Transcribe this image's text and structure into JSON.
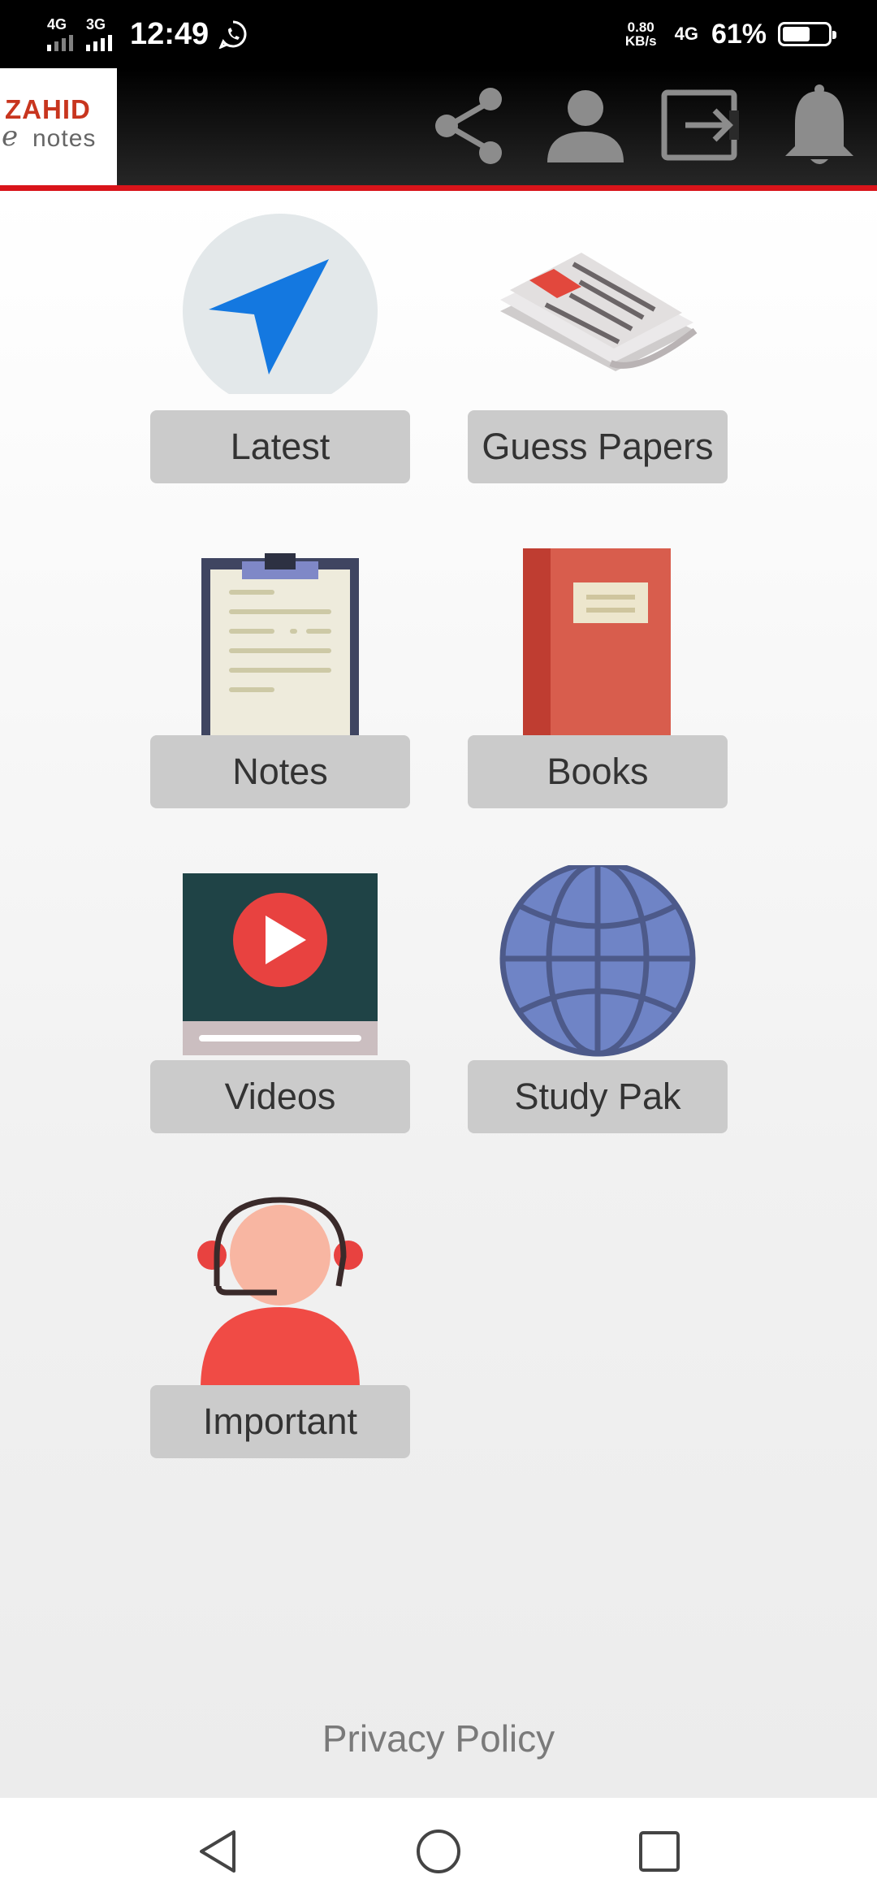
{
  "status_bar": {
    "sim1_network": "4G",
    "sim2_network": "3G",
    "time": "12:49",
    "speed_value": "0.80",
    "speed_unit": "KB/s",
    "data_network": "4G",
    "battery_percent": "61%",
    "battery_level": 0.61
  },
  "header": {
    "logo_text_top": "ZAHID",
    "logo_text_e": "e",
    "logo_text_bottom": "notes",
    "icons": [
      "share-icon",
      "profile-icon",
      "logout-icon",
      "bell-icon"
    ],
    "accent_color": "#d9141a"
  },
  "menu": {
    "latest": "Latest",
    "guess_papers": "Guess Papers",
    "notes": "Notes",
    "books": "Books",
    "videos": "Videos",
    "study_pak": "Study Pak",
    "important": "Important"
  },
  "footer": {
    "privacy_policy": "Privacy Policy"
  },
  "nav_bar": {
    "icons": [
      "back-icon",
      "home-icon",
      "recents-icon"
    ]
  }
}
